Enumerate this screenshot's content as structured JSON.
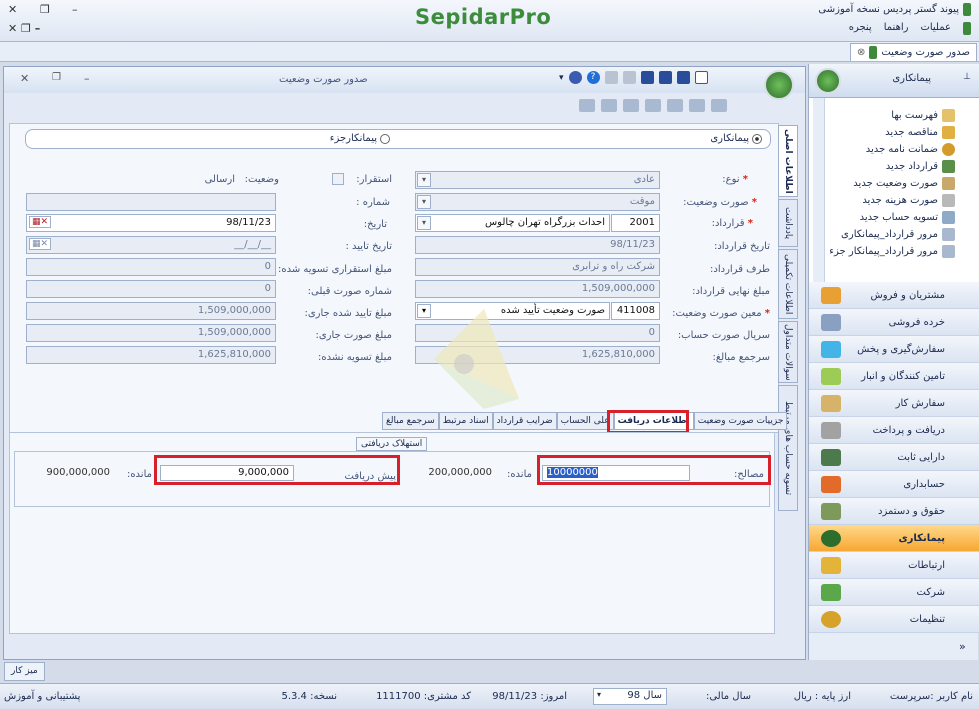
{
  "app": {
    "brand": "SepidarPro",
    "title_right": "پیوند گستر پردیس نسخه آموزشی",
    "menu": [
      "عملیات",
      "راهنما",
      "پنجره"
    ]
  },
  "doc_tab": "صدور صورت وضعیت",
  "window": {
    "title": "صدور صورت وضعیت"
  },
  "nav": {
    "header": "پیمانکاری",
    "items": [
      "فهرست بها",
      "مناقصه جدید",
      "ضمانت نامه جدید",
      "قرارداد جدید",
      "صورت وضعیت جدید",
      "صورت هزینه جدید",
      "تسویه حساب جدید",
      "مرور قرارداد_پیمانکاری",
      "مرور قرارداد_پیمانکار جزء"
    ],
    "modules": [
      "مشتریان و فروش",
      "خرده فروشی",
      "سفارش‌گیری و پخش",
      "تامین کنندگان و انبار",
      "سفارش کار",
      "دریافت و پرداخت",
      "دارایی ثابت",
      "حسابداری",
      "حقوق و دستمزد",
      "پیمانکاری",
      "ارتباطات",
      "شرکت",
      "تنظیمات"
    ],
    "active": "پیمانکاری"
  },
  "radio": {
    "main": "پیمانکاری",
    "sub": "پیمانکارجزء"
  },
  "side_tabs": [
    "اطلاعات اصلی",
    "یادداشت",
    "اطلاعات تکمیلی",
    "سوالات متداول",
    "تسویه حساب های مرتبط"
  ],
  "form": {
    "type_label": "نوع:",
    "type_value": "عادی",
    "status_label": "صورت وضعیت:",
    "status_value": "موقت",
    "contract_label": "قرارداد:",
    "contract_code": "2001",
    "contract_name": "احداث بزرگراه تهران چالوس",
    "contract_date_label": "تاریخ قرارداد:",
    "contract_date": "98/11/23",
    "party_label": "طرف قرارداد:",
    "party_value": "شرکت راه و ترابری",
    "final_amount_label": "مبلغ نهایی قرارداد:",
    "final_amount": "1,509,000,000",
    "designator_label": "معین صورت وضعیت:",
    "designator_code": "411008",
    "designator_name": "صورت وضعیت تأیید شده",
    "account_serial_label": "سریال صورت حساب:",
    "account_serial": "0",
    "total_label": "سرجمع مبالغ:",
    "total_amount": "1,625,810,000",
    "deploy_label": "استقرار:",
    "state_label": "وضعیت:",
    "state_value": "ارسالی",
    "number_label": "شماره :",
    "date_label": "تاریخ:",
    "date_value": "98/11/23",
    "approve_date_label": "تاریخ تایید :",
    "approve_date": "__/__/__",
    "settle_deploy_label": "مبلغ استقراری تسویه شده:",
    "settle_deploy": "0",
    "prev_number_label": "شماره صورت قبلی:",
    "prev_number": "0",
    "approved_current_label": "مبلغ تایید شده جاری:",
    "approved_current": "1,509,000,000",
    "current_amount_label": "مبلغ صورت جاری:",
    "current_amount": "1,509,000,000",
    "unsettled_label": "مبلغ تسویه نشده:",
    "unsettled": "1,625,810,000"
  },
  "bottom_tabs": [
    "جزییات صورت وضعیت",
    "اطلاعات دریافت",
    "علی الحساب",
    "ضرایب قرارداد",
    "اسناد مرتبط",
    "سرجمع مبالغ"
  ],
  "selected_bottom_tab": "اطلاعات دریافت",
  "amortization": {
    "group_title": "استهلاک دریافتی",
    "materials_label": "مصالح:",
    "materials_value": "10000000",
    "remain_label": "مانده:",
    "remain1": "200,000,000",
    "prepay_label": "پیش دریافت",
    "prepay_value": "9,000,000",
    "remain2": "900,000,000"
  },
  "taskbar": {
    "desk": "میز کار"
  },
  "status": {
    "user": "نام کاربر :سرپرست",
    "currency": "ارز پایه :   ریال",
    "fiscal_label": "سال مالی:",
    "fiscal_year": "سال 98",
    "today": "امروز:   98/11/23",
    "customer": "کد مشتری:   1111700",
    "version": "نسخه:   5.3.4",
    "support": "پشتیبانی و آموزش"
  }
}
